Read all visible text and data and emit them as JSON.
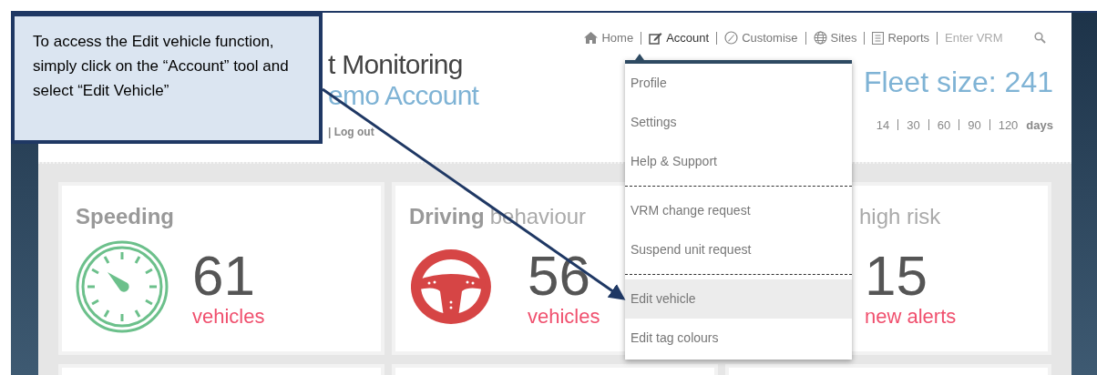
{
  "nav": {
    "items": [
      {
        "kind": "home",
        "label": "Home",
        "selected": false
      },
      {
        "kind": "edit",
        "label": "Account",
        "selected": true
      },
      {
        "kind": "brush",
        "label": "Customise",
        "selected": false
      },
      {
        "kind": "globe",
        "label": "Sites",
        "selected": false
      },
      {
        "kind": "report",
        "label": "Reports",
        "selected": false
      }
    ],
    "search": {
      "placeholder": "Enter VRM"
    }
  },
  "header": {
    "title": "t Monitoring",
    "subtitle": "emo Account",
    "logout": "| Log out",
    "fleet_size": "Fleet size: 241",
    "periods": [
      "14",
      "30",
      "60",
      "90",
      "120"
    ],
    "periods_unit": "days"
  },
  "cards": [
    {
      "kind": "gauge",
      "title": "Speeding",
      "count": "61",
      "unit": "vehicles"
    },
    {
      "kind": "wheel",
      "title": "Driving",
      "subtitle": "behaviour",
      "count": "56",
      "unit": "vehicles"
    },
    {
      "kind": "alerts",
      "subtitle": "high risk",
      "count": "15",
      "unit": "new alerts"
    }
  ],
  "dropdown": {
    "groups": [
      [
        {
          "label": "Profile",
          "selected": false
        },
        {
          "label": "Settings",
          "selected": false
        },
        {
          "label": "Help & Support",
          "selected": false
        }
      ],
      [
        {
          "label": "VRM change request",
          "selected": false
        },
        {
          "label": "Suspend unit request",
          "selected": false
        }
      ],
      [
        {
          "label": "Edit vehicle",
          "selected": true
        },
        {
          "label": "Edit tag colours",
          "selected": false
        }
      ]
    ]
  },
  "callout": {
    "text": "To access the Edit vehicle function, simply click on the “Account” tool and select “Edit Vehicle”"
  }
}
